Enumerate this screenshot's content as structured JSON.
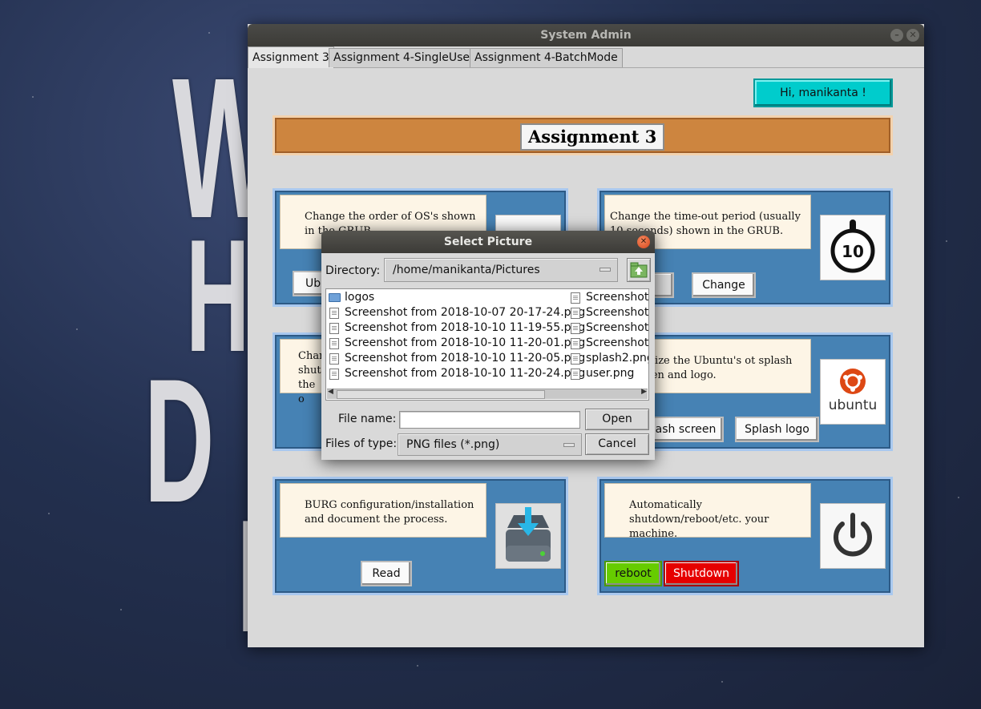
{
  "desktop": {
    "bg_letters": [
      "W",
      "H",
      "D",
      "I"
    ]
  },
  "window": {
    "title": "System Admin",
    "tabs": [
      {
        "label": "Assignment 3",
        "active": true
      },
      {
        "label": "Assignment 4-SingleUser",
        "active": false
      },
      {
        "label": "Assignment 4-BatchMode",
        "active": false
      }
    ],
    "greeting": "Hi, manikanta !",
    "banner_title": "Assignment 3",
    "panels": [
      {
        "text": "Change the order of OS's shown in the GRUB.",
        "button": "Ubu",
        "icon": "grub-order-icon"
      },
      {
        "text": "Change the time-out period (usually 10 seconds) shown in the GRUB.",
        "button": "Change",
        "icon": "timer-10-icon",
        "timer_value": "10"
      },
      {
        "text": "Char shutd the o",
        "icon": ""
      },
      {
        "text": "stomize the Ubuntu's ot splash screen and logo.",
        "buttons": [
          "ash screen",
          "Splash logo"
        ],
        "icon": "ubuntu-logo-icon",
        "logo_text": "ubuntu"
      },
      {
        "text": "BURG configuration/installation and document the process.",
        "button": "Read",
        "icon": "download-drive-icon"
      },
      {
        "text": "Automatically shutdown/reboot/etc. your machine.",
        "buttons": [
          "reboot",
          "Shutdown"
        ],
        "icon": "power-icon"
      }
    ]
  },
  "dialog": {
    "title": "Select Picture",
    "directory_label": "Directory:",
    "directory_value": "/home/manikanta/Pictures",
    "files_left": [
      {
        "name": "logos",
        "type": "folder"
      },
      {
        "name": "Screenshot from 2018-10-07 20-17-24.png",
        "type": "file"
      },
      {
        "name": "Screenshot from 2018-10-10 11-19-55.png",
        "type": "file"
      },
      {
        "name": "Screenshot from 2018-10-10 11-20-01.png",
        "type": "file"
      },
      {
        "name": "Screenshot from 2018-10-10 11-20-05.png",
        "type": "file"
      },
      {
        "name": "Screenshot from 2018-10-10 11-20-24.png",
        "type": "file"
      }
    ],
    "files_right": [
      {
        "name": "Screenshot f",
        "type": "file"
      },
      {
        "name": "Screenshot f",
        "type": "file"
      },
      {
        "name": "Screenshot f",
        "type": "file"
      },
      {
        "name": "Screenshot f",
        "type": "file"
      },
      {
        "name": "splash2.png",
        "type": "file"
      },
      {
        "name": "user.png",
        "type": "file"
      }
    ],
    "filename_label": "File name:",
    "filename_value": "",
    "filetype_label": "Files of type:",
    "filetype_value": "PNG files (*.png)",
    "open_label": "Open",
    "cancel_label": "Cancel"
  },
  "colors": {
    "panel_blue": "#4682b4",
    "banner_orange": "#cd853f",
    "greeting_cyan": "#00cccc",
    "reboot_green": "#66cc00",
    "shutdown_red": "#e60000"
  }
}
